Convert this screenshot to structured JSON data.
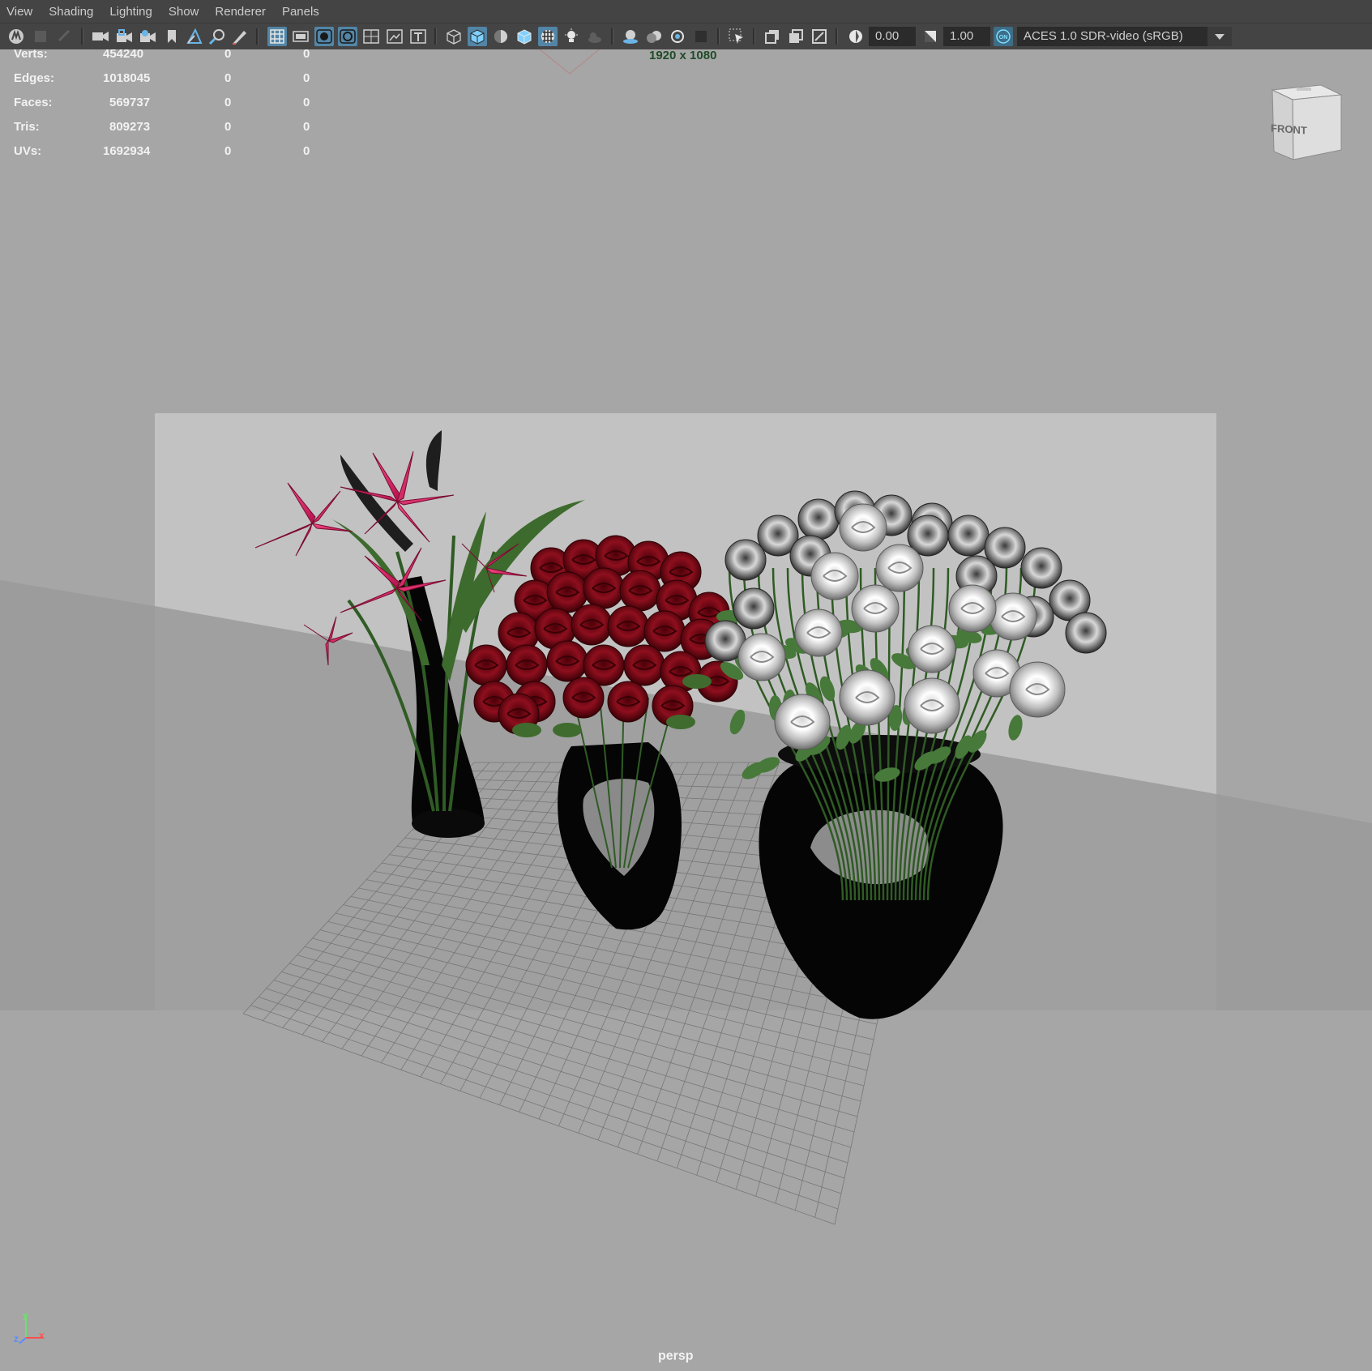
{
  "menu": [
    "View",
    "Shading",
    "Lighting",
    "Show",
    "Renderer",
    "Panels"
  ],
  "toolbar": {
    "exposure": "0.00",
    "gamma": "1.00",
    "color_management_toggle": "ON",
    "view_transform": "ACES 1.0 SDR-video (sRGB)",
    "icons": [
      "maya-logo-icon",
      "camera-lock-icon",
      "select-camera-icon",
      "camera-attributes-icon",
      "bookmark-icon",
      "image-plane-icon",
      "two-d-pan-zoom-icon",
      "grease-pencil-icon",
      "grid-icon",
      "film-gate-icon",
      "resolution-gate-icon",
      "gate-mask-icon",
      "field-chart-icon",
      "safe-action-icon",
      "safe-title-icon",
      "wireframe-icon",
      "smooth-shade-icon",
      "use-default-material-icon",
      "wireframe-on-shaded-icon",
      "textured-icon",
      "use-all-lights-icon",
      "shadows-icon",
      "screen-space-ao-icon",
      "motion-blur-icon",
      "anti-aliasing-icon",
      "depth-of-field-icon",
      "isolate-select-icon",
      "xray-icon",
      "xray-joints-icon",
      "xray-components-icon",
      "exposure-icon",
      "gamma-icon",
      "color-management-icon"
    ]
  },
  "hud": {
    "rows": [
      {
        "label": "Verts:",
        "total": "454240",
        "selected": "0",
        "tri": "0"
      },
      {
        "label": "Edges:",
        "total": "1018045",
        "selected": "0",
        "tri": "0"
      },
      {
        "label": "Faces:",
        "total": "569737",
        "selected": "0",
        "tri": "0"
      },
      {
        "label": "Tris:",
        "total": "809273",
        "selected": "0",
        "tri": "0"
      },
      {
        "label": "UVs:",
        "total": "1692934",
        "selected": "0",
        "tri": "0"
      }
    ],
    "resolution": "1920 x 1080",
    "camera": "persp"
  },
  "viewcube": {
    "face": "FRONT"
  },
  "axis": {
    "x": "x",
    "y": "y",
    "z": "z"
  },
  "colors": {
    "panel_bg": "#444444",
    "viewport_bg": "#a6a6a6",
    "active_button": "#5285a6",
    "resolution_text": "#1f4c27",
    "lily": "#d81b60",
    "red_rose": "#7a0a14",
    "white_rose": "#e8e8e8",
    "stem": "#3f6b2e",
    "vase": "#050505"
  }
}
